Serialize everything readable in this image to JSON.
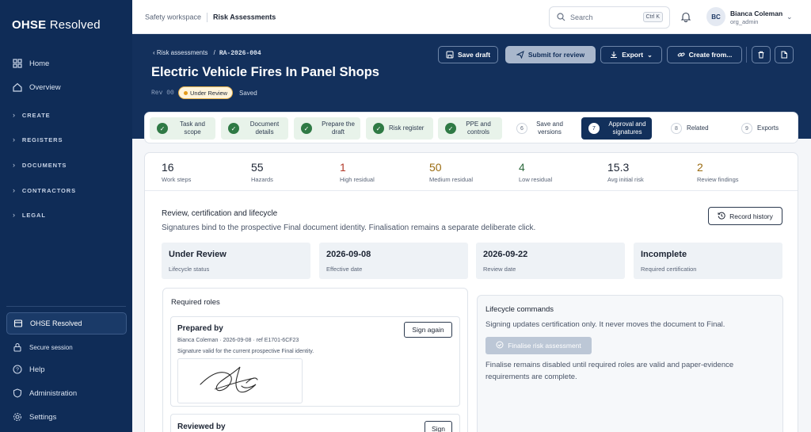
{
  "sidebar": {
    "brand_prefix": "OHSE",
    "brand_suffix": "Resolved",
    "nav": [
      {
        "label": "Home",
        "icon": "grid-icon"
      },
      {
        "label": "Overview",
        "icon": "home-icon"
      }
    ],
    "sections": [
      "CREATE",
      "REGISTERS",
      "DOCUMENTS",
      "CONTRACTORS",
      "LEGAL"
    ],
    "org": "OHSE Resolved",
    "bottom": [
      {
        "label": "Secure session",
        "icon": "lock-icon"
      },
      {
        "label": "Help",
        "icon": "help-icon"
      },
      {
        "label": "Administration",
        "icon": "shield-icon"
      },
      {
        "label": "Settings",
        "icon": "gear-icon"
      }
    ]
  },
  "topbar": {
    "workspace": "Safety workspace",
    "page": "Risk Assessments",
    "search_placeholder": "Search",
    "shortcut": "Ctrl K",
    "user": {
      "initials": "BC",
      "name": "Bianca Coleman",
      "role": "org_admin"
    }
  },
  "header": {
    "back_label": "Risk assessments",
    "doc_id": "RA-2026-004",
    "title": "Electric Vehicle Fires In Panel Shops",
    "rev": "Rev 00",
    "status": "Under Review",
    "saved": "Saved",
    "buttons": {
      "save_draft": "Save draft",
      "submit": "Submit for review",
      "export": "Export",
      "create_from": "Create from..."
    }
  },
  "steps": [
    {
      "label": "Task and scope",
      "state": "done"
    },
    {
      "label": "Document details",
      "state": "done"
    },
    {
      "label": "Prepare the draft",
      "state": "done"
    },
    {
      "label": "Risk register",
      "state": "done"
    },
    {
      "label": "PPE and controls",
      "state": "done"
    },
    {
      "num": "6",
      "label": "Save and versions",
      "state": "todo"
    },
    {
      "num": "7",
      "label": "Approval and signatures",
      "state": "active"
    },
    {
      "num": "8",
      "label": "Related",
      "state": "todo"
    },
    {
      "num": "9",
      "label": "Exports",
      "state": "todo"
    }
  ],
  "stats": [
    {
      "value": "16",
      "label": "Work steps",
      "color": "#1c2433"
    },
    {
      "value": "55",
      "label": "Hazards",
      "color": "#1c2433"
    },
    {
      "value": "1",
      "label": "High residual",
      "color": "#b23a2a"
    },
    {
      "value": "50",
      "label": "Medium residual",
      "color": "#9a6b10"
    },
    {
      "value": "4",
      "label": "Low residual",
      "color": "#2f6b3f"
    },
    {
      "value": "15.3",
      "label": "Avg initial risk",
      "color": "#1c2433"
    },
    {
      "value": "2",
      "label": "Review findings",
      "color": "#9a6b10"
    }
  ],
  "review": {
    "title": "Review, certification and lifecycle",
    "subtitle": "Signatures bind to the prospective Final document identity. Finalisation remains a separate deliberate click.",
    "record_history": "Record history",
    "tiles": [
      {
        "value": "Under Review",
        "label": "Lifecycle status"
      },
      {
        "value": "2026-09-08",
        "label": "Effective date"
      },
      {
        "value": "2026-09-22",
        "label": "Review date"
      },
      {
        "value": "Incomplete",
        "label": "Required certification"
      }
    ]
  },
  "roles": {
    "title": "Required roles",
    "prepared": {
      "title": "Prepared by",
      "meta": "Bianca Coleman · 2026-09-08 · ref E1701-6CF23",
      "note": "Signature valid for the current prospective Final identity.",
      "button": "Sign again"
    },
    "reviewed": {
      "title": "Reviewed by",
      "button": "Sign"
    }
  },
  "lifecycle": {
    "title": "Lifecycle commands",
    "desc": "Signing updates certification only. It never moves the document to Final.",
    "finalise": "Finalise risk assessment",
    "note": "Finalise remains disabled until required roles are valid and paper-evidence requirements are complete."
  }
}
